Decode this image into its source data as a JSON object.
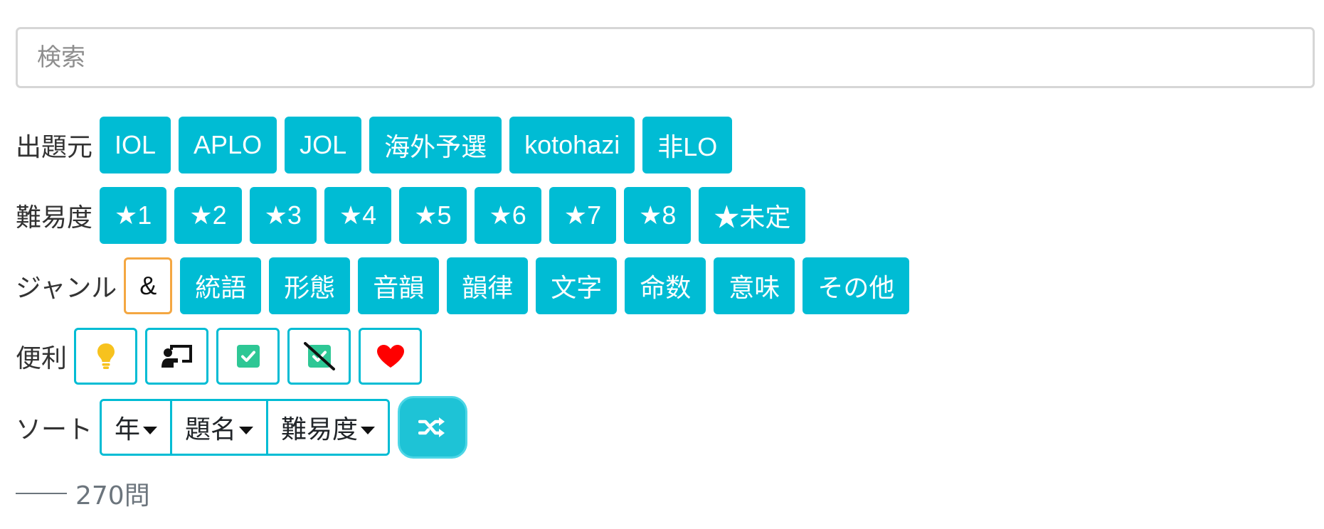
{
  "search": {
    "placeholder": "検索"
  },
  "source": {
    "label": "出題元",
    "items": [
      "IOL",
      "APLO",
      "JOL",
      "海外予選",
      "kotohazi",
      "非LO"
    ]
  },
  "difficulty": {
    "label": "難易度",
    "items": [
      "★1",
      "★2",
      "★3",
      "★4",
      "★5",
      "★6",
      "★7",
      "★8",
      "★未定"
    ]
  },
  "genre": {
    "label": "ジャンル",
    "amp_label": "&",
    "items": [
      "統語",
      "形態",
      "音韻",
      "韻律",
      "文字",
      "命数",
      "意味",
      "その他"
    ]
  },
  "tools": {
    "label": "便利",
    "icons": [
      "lightbulb-icon",
      "chalkboard-teacher-icon",
      "checkbox-checked-icon",
      "checkbox-crossed-icon",
      "heart-icon"
    ]
  },
  "sort": {
    "label": "ソート",
    "options": [
      "年",
      "題名",
      "難易度"
    ],
    "shuffle_icon": "shuffle-icon"
  },
  "result": {
    "count_text": "270問"
  },
  "colors": {
    "accent": "#00bcd4",
    "amp_border": "#f4a742",
    "bulb": "#f7c21e",
    "check": "#2ec795",
    "heart": "#ff0000"
  }
}
